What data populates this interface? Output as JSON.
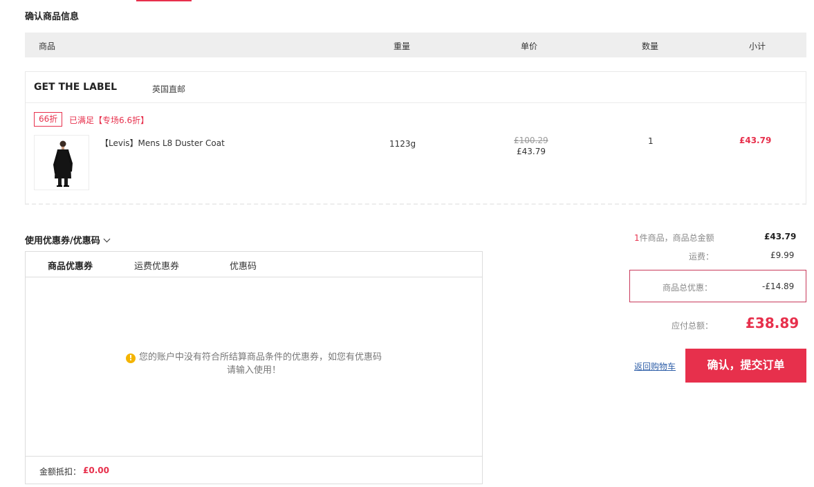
{
  "section_title": "确认商品信息",
  "table_header": {
    "product": "商品",
    "weight": "重量",
    "unit_price": "单价",
    "quantity": "数量",
    "subtotal": "小计"
  },
  "store": {
    "name": "GET THE LABEL",
    "shipping": "英国直邮"
  },
  "promo": {
    "tag": "66折",
    "text": "已满足【专场6.6折】"
  },
  "item": {
    "name": "【Levis】Mens L8 Duster Coat",
    "weight": "1123g",
    "original_price": "£100.29",
    "price": "£43.79",
    "quantity": "1",
    "subtotal": "£43.79"
  },
  "coupon": {
    "title": "使用优惠券/优惠码",
    "tabs": [
      "商品优惠券",
      "运费优惠券",
      "优惠码"
    ],
    "empty_line1": "您的账户中没有符合所结算商品条件的优惠券，如您有优惠码",
    "empty_line2": "请输入使用！",
    "deduct_label": "金额抵扣：",
    "deduct_value": "£0.00"
  },
  "summary": {
    "count": "1",
    "count_suffix": "件商品，商品总金额",
    "goods_total": "£43.79",
    "shipping_label": "运费：",
    "shipping_value": "£9.99",
    "discount_label": "商品总优惠：",
    "discount_value": "-£14.89",
    "payable_label": "应付总额：",
    "payable_value": "£38.89"
  },
  "actions": {
    "back_to_cart": "返回购物车",
    "submit": "确认，提交订单"
  },
  "colors": {
    "accent": "#e7304c",
    "link": "#2f5fa8",
    "warning": "#f4b400"
  }
}
